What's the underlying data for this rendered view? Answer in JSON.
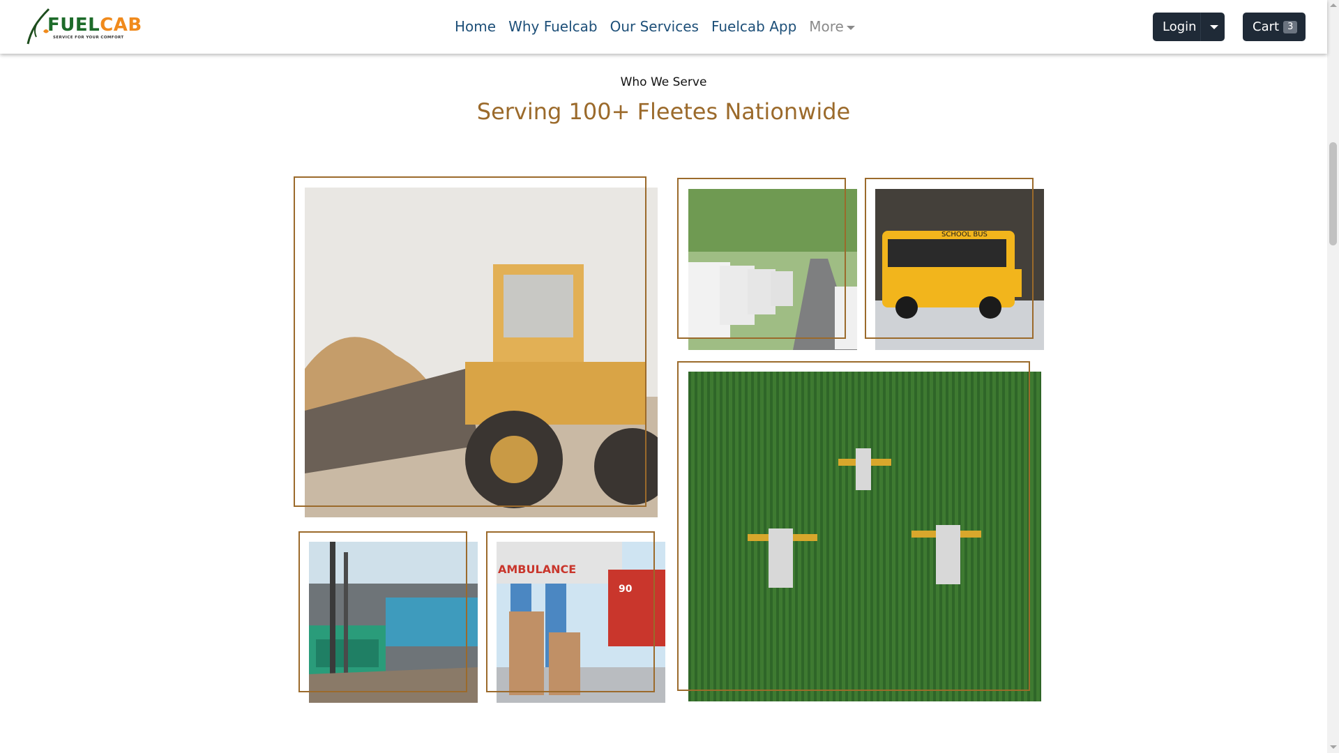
{
  "brand": {
    "name_part1": "FUEL",
    "name_part2": "CAB",
    "tagline": "SERVICE FOR YOUR COMFORT",
    "colors": {
      "green": "#1d6b2a",
      "orange": "#f08a1c"
    }
  },
  "nav": {
    "links": [
      {
        "label": "Home"
      },
      {
        "label": "Why Fuelcab"
      },
      {
        "label": "Our Services"
      },
      {
        "label": "Fuelcab App"
      }
    ],
    "more_label": "More",
    "login_label": "Login",
    "cart_label": "Cart",
    "cart_count": "3"
  },
  "section": {
    "eyebrow": "Who We Serve",
    "headline": "Serving 100+ Fleetes Nationwide",
    "accent_color": "#9b6a2b"
  },
  "gallery": [
    {
      "name": "construction-loader-photo",
      "icon": "wheel-loader"
    },
    {
      "name": "delivery-vans-photo",
      "icon": "van-fleet"
    },
    {
      "name": "school-bus-photo",
      "icon": "school-bus",
      "sign_text": "SCHOOL BUS"
    },
    {
      "name": "agriculture-field-photo",
      "icon": "crop-sprayers"
    },
    {
      "name": "power-generators-photo",
      "icon": "generators"
    },
    {
      "name": "ambulance-photo",
      "icon": "ambulance",
      "sign_text": "AMBULANCE",
      "number_text": "90"
    }
  ]
}
